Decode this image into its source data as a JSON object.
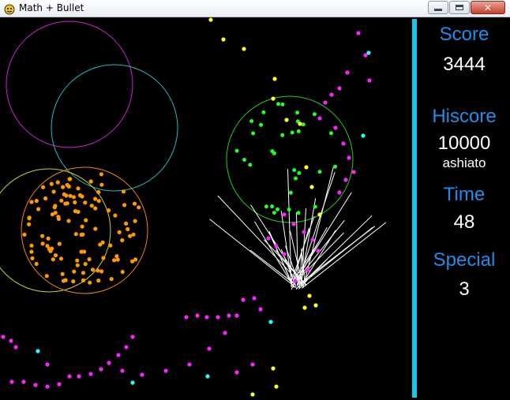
{
  "window": {
    "title": "Math + Bullet"
  },
  "hud": {
    "score_label": "Score",
    "score_value": "3444",
    "hiscore_label": "Hiscore",
    "hiscore_value": "10000",
    "hiscore_name": "ashiato",
    "time_label": "Time",
    "time_value": "48",
    "special_label": "Special",
    "special_value": "3"
  },
  "colors": {
    "hud_label": "#1f8ee8",
    "hud_value": "#ffffff",
    "divider": "#19c4e8",
    "bullet_magenta": "#ff22ff",
    "bullet_yellow": "#ffff22",
    "bullet_cyan": "#22ffff",
    "bullet_orange": "#ff9900",
    "bullet_green": "#22ff22",
    "ring_magenta": "#cc22cc",
    "ring_cyan": "#22bbbb",
    "ring_yellow": "#cccc33",
    "ring_orange": "#ee8800",
    "ring_green": "#22cc22"
  }
}
